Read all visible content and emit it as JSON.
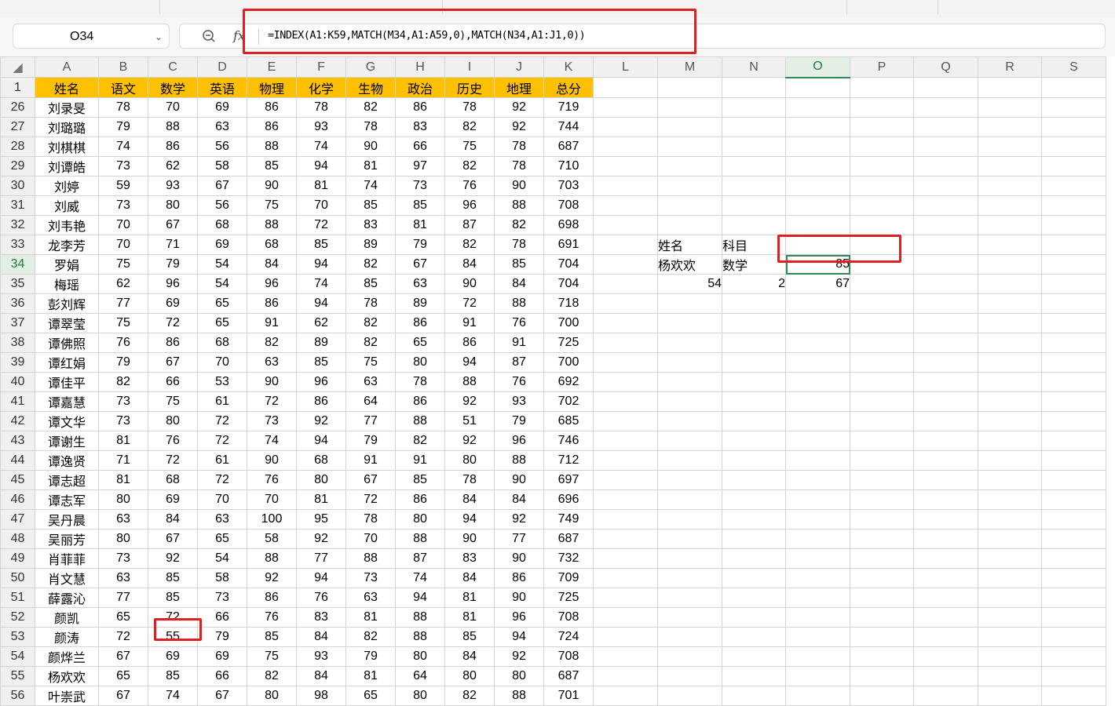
{
  "formula": {
    "name_box": "O34",
    "fx_label": "fx",
    "content": "=INDEX(A1:K59,MATCH(M34,A1:A59,0),MATCH(N34,A1:J1,0))"
  },
  "columns": [
    "A",
    "B",
    "C",
    "D",
    "E",
    "F",
    "G",
    "H",
    "I",
    "J",
    "K",
    "L",
    "M",
    "N",
    "O",
    "P",
    "Q",
    "R",
    "S"
  ],
  "header_row": {
    "row_num": "1",
    "cells": [
      "姓名",
      "语文",
      "数学",
      "英语",
      "物理",
      "化学",
      "生物",
      "政治",
      "历史",
      "地理",
      "总分"
    ]
  },
  "rows": [
    {
      "n": "26",
      "name": "刘录旻",
      "vals": [
        "78",
        "70",
        "69",
        "86",
        "78",
        "82",
        "86",
        "78",
        "92",
        "719"
      ]
    },
    {
      "n": "27",
      "name": "刘璐璐",
      "vals": [
        "79",
        "88",
        "63",
        "86",
        "93",
        "78",
        "83",
        "82",
        "92",
        "744"
      ]
    },
    {
      "n": "28",
      "name": "刘棋棋",
      "vals": [
        "74",
        "86",
        "56",
        "88",
        "74",
        "90",
        "66",
        "75",
        "78",
        "687"
      ]
    },
    {
      "n": "29",
      "name": "刘谭皓",
      "vals": [
        "73",
        "62",
        "58",
        "85",
        "94",
        "81",
        "97",
        "82",
        "78",
        "710"
      ]
    },
    {
      "n": "30",
      "name": "刘婷",
      "vals": [
        "59",
        "93",
        "67",
        "90",
        "81",
        "74",
        "73",
        "76",
        "90",
        "703"
      ]
    },
    {
      "n": "31",
      "name": "刘威",
      "vals": [
        "73",
        "80",
        "56",
        "75",
        "70",
        "85",
        "85",
        "96",
        "88",
        "708"
      ]
    },
    {
      "n": "32",
      "name": "刘韦艳",
      "vals": [
        "70",
        "67",
        "68",
        "88",
        "72",
        "83",
        "81",
        "87",
        "82",
        "698"
      ]
    },
    {
      "n": "33",
      "name": "龙李芳",
      "vals": [
        "70",
        "71",
        "69",
        "68",
        "85",
        "89",
        "79",
        "82",
        "78",
        "691"
      ]
    },
    {
      "n": "34",
      "name": "罗娟",
      "vals": [
        "75",
        "79",
        "54",
        "84",
        "94",
        "82",
        "67",
        "84",
        "85",
        "704"
      ]
    },
    {
      "n": "35",
      "name": "梅瑶",
      "vals": [
        "62",
        "96",
        "54",
        "96",
        "74",
        "85",
        "63",
        "90",
        "84",
        "704"
      ]
    },
    {
      "n": "36",
      "name": "彭刘辉",
      "vals": [
        "77",
        "69",
        "65",
        "86",
        "94",
        "78",
        "89",
        "72",
        "88",
        "718"
      ]
    },
    {
      "n": "37",
      "name": "谭翠莹",
      "vals": [
        "75",
        "72",
        "65",
        "91",
        "62",
        "82",
        "86",
        "91",
        "76",
        "700"
      ]
    },
    {
      "n": "38",
      "name": "谭佛照",
      "vals": [
        "76",
        "86",
        "68",
        "82",
        "89",
        "82",
        "65",
        "86",
        "91",
        "725"
      ]
    },
    {
      "n": "39",
      "name": "谭红娟",
      "vals": [
        "79",
        "67",
        "70",
        "63",
        "85",
        "75",
        "80",
        "94",
        "87",
        "700"
      ]
    },
    {
      "n": "40",
      "name": "谭佳平",
      "vals": [
        "82",
        "66",
        "53",
        "90",
        "96",
        "63",
        "78",
        "88",
        "76",
        "692"
      ]
    },
    {
      "n": "41",
      "name": "谭嘉慧",
      "vals": [
        "73",
        "75",
        "61",
        "72",
        "86",
        "64",
        "86",
        "92",
        "93",
        "702"
      ]
    },
    {
      "n": "42",
      "name": "谭文华",
      "vals": [
        "73",
        "80",
        "72",
        "73",
        "92",
        "77",
        "88",
        "51",
        "79",
        "685"
      ]
    },
    {
      "n": "43",
      "name": "谭谢生",
      "vals": [
        "81",
        "76",
        "72",
        "74",
        "94",
        "79",
        "82",
        "92",
        "96",
        "746"
      ]
    },
    {
      "n": "44",
      "name": "谭逸贤",
      "vals": [
        "71",
        "72",
        "61",
        "90",
        "68",
        "91",
        "91",
        "80",
        "88",
        "712"
      ]
    },
    {
      "n": "45",
      "name": "谭志超",
      "vals": [
        "81",
        "68",
        "72",
        "76",
        "80",
        "67",
        "85",
        "78",
        "90",
        "697"
      ]
    },
    {
      "n": "46",
      "name": "谭志军",
      "vals": [
        "80",
        "69",
        "70",
        "70",
        "81",
        "72",
        "86",
        "84",
        "84",
        "696"
      ]
    },
    {
      "n": "47",
      "name": "吴丹晨",
      "vals": [
        "63",
        "84",
        "63",
        "100",
        "95",
        "78",
        "80",
        "94",
        "92",
        "749"
      ]
    },
    {
      "n": "48",
      "name": "吴丽芳",
      "vals": [
        "80",
        "67",
        "65",
        "58",
        "92",
        "70",
        "88",
        "90",
        "77",
        "687"
      ]
    },
    {
      "n": "49",
      "name": "肖菲菲",
      "vals": [
        "73",
        "92",
        "54",
        "88",
        "77",
        "88",
        "87",
        "83",
        "90",
        "732"
      ]
    },
    {
      "n": "50",
      "name": "肖文慧",
      "vals": [
        "63",
        "85",
        "58",
        "92",
        "94",
        "73",
        "74",
        "84",
        "86",
        "709"
      ]
    },
    {
      "n": "51",
      "name": "薛露沁",
      "vals": [
        "77",
        "85",
        "73",
        "86",
        "76",
        "63",
        "94",
        "81",
        "90",
        "725"
      ]
    },
    {
      "n": "52",
      "name": "颜凯",
      "vals": [
        "65",
        "72",
        "66",
        "76",
        "83",
        "81",
        "88",
        "81",
        "96",
        "708"
      ]
    },
    {
      "n": "53",
      "name": "颜涛",
      "vals": [
        "72",
        "55",
        "79",
        "85",
        "84",
        "82",
        "88",
        "85",
        "94",
        "724"
      ]
    },
    {
      "n": "54",
      "name": "颜烨兰",
      "vals": [
        "67",
        "69",
        "69",
        "75",
        "93",
        "79",
        "80",
        "84",
        "92",
        "708"
      ]
    },
    {
      "n": "55",
      "name": "杨欢欢",
      "vals": [
        "65",
        "85",
        "66",
        "82",
        "84",
        "81",
        "64",
        "80",
        "80",
        "687"
      ]
    },
    {
      "n": "56",
      "name": "叶崇武",
      "vals": [
        "67",
        "74",
        "67",
        "80",
        "98",
        "65",
        "80",
        "82",
        "88",
        "701"
      ]
    }
  ],
  "lookup": {
    "r33": {
      "m": "姓名",
      "n": "科目",
      "o": ""
    },
    "r34": {
      "m": "杨欢欢",
      "n": "数学",
      "o": "85"
    },
    "r35": {
      "m": "54",
      "n": "2",
      "o": "67"
    }
  }
}
